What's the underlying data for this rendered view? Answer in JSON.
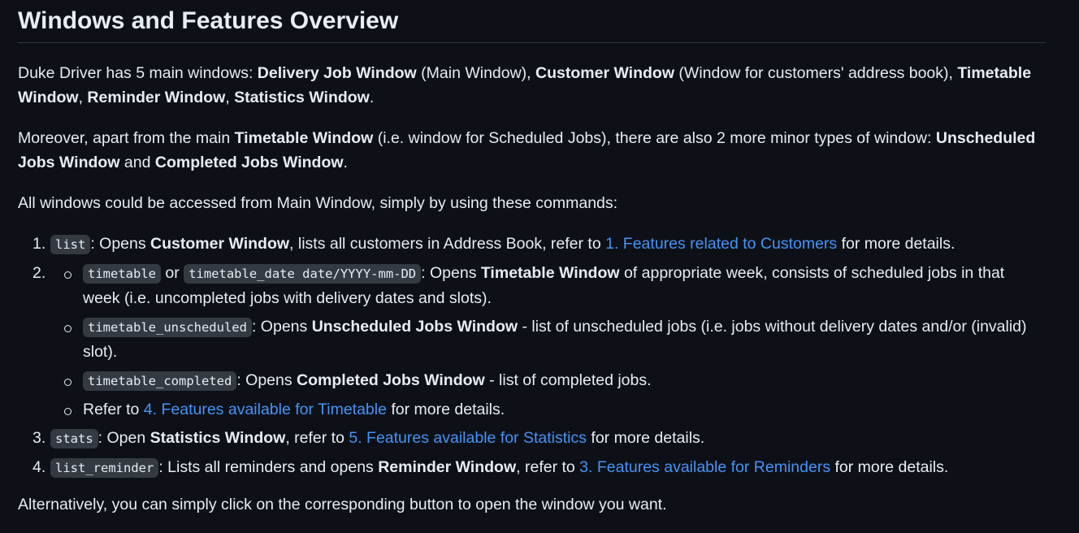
{
  "title": "Windows and Features Overview",
  "intro": {
    "t1": "Duke Driver has 5 main windows: ",
    "b1": "Delivery Job Window",
    "t2": " (Main Window), ",
    "b2": "Customer Window",
    "t3": " (Window for customers' address book), ",
    "b3": "Timetable Window",
    "t4": ", ",
    "b4": "Reminder Window",
    "t5": ", ",
    "b5": "Statistics Window",
    "t6": "."
  },
  "minor": {
    "t1": "Moreover, apart from the main ",
    "b1": "Timetable Window",
    "t2": " (i.e. window for Scheduled Jobs), there are also 2 more minor types of window: ",
    "b2": "Unscheduled Jobs Window",
    "t3": " and ",
    "b3": "Completed Jobs Window",
    "t4": "."
  },
  "access": "All windows could be accessed from Main Window, simply by using these commands:",
  "items": [
    {
      "num": "1.",
      "code": "list",
      "t1": ": Opens ",
      "b1": "Customer Window",
      "t2": ", lists all customers in Address Book, refer to ",
      "link": "1. Features related to Customers",
      "t3": " for more details."
    },
    {
      "num": "2.",
      "sub": [
        {
          "code1": "timetable",
          "or": " or ",
          "code2": "timetable_date date/YYYY-mm-DD",
          "t1": ": Opens ",
          "b1": "Timetable Window",
          "t2": " of appropriate week, consists of scheduled jobs in that week (i.e. uncompleted jobs with delivery dates and slots)."
        },
        {
          "code": "timetable_unscheduled",
          "t1": ": Opens ",
          "b1": "Unscheduled Jobs Window",
          "t2": " - list of unscheduled jobs (i.e. jobs without delivery dates and/or (invalid) slot)."
        },
        {
          "code": "timetable_completed",
          "t1": ": Opens ",
          "b1": "Completed Jobs Window",
          "t2": " - list of completed jobs."
        },
        {
          "t1": "Refer to ",
          "link": "4. Features available for Timetable",
          "t2": " for more details."
        }
      ]
    },
    {
      "num": "3.",
      "code": "stats",
      "t1": ": Open ",
      "b1": "Statistics Window",
      "t2": ", refer to ",
      "link": "5. Features available for Statistics",
      "t3": " for more details."
    },
    {
      "num": "4.",
      "code": "list_reminder",
      "t1": ": Lists all reminders and opens ",
      "b1": "Reminder Window",
      "t2": ", refer to ",
      "link": "3. Features available for Reminders",
      "t3": " for more details."
    }
  ],
  "alternative": "Alternatively, you can simply click on the corresponding button to open the window you want.",
  "colors": {
    "background": "#0d1117",
    "text": "#e6edf3",
    "link": "#4493f8",
    "code_bg": "#343a42",
    "divider": "#30363d"
  }
}
